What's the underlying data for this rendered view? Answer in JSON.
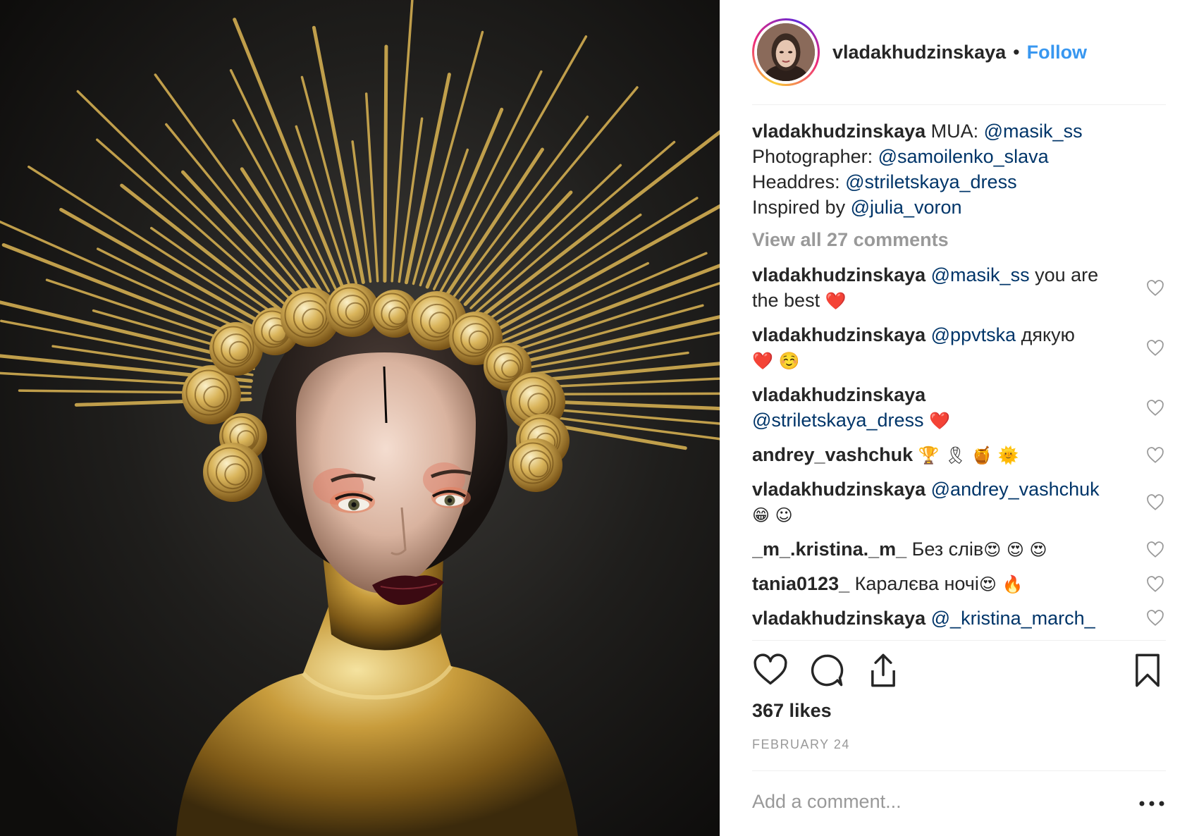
{
  "post": {
    "author": "vladakhudzinskaya",
    "separator": "•",
    "follow_label": "Follow",
    "likes": "367 likes",
    "date": "FEBRUARY 24",
    "add_comment_placeholder": "Add a comment...",
    "view_all_comments": "View all 27 comments"
  },
  "caption": {
    "user": "vladakhudzinskaya",
    "lines": [
      {
        "prefix": " MUA: ",
        "mention": "@masik_ss"
      },
      {
        "prefix": "Photographer: ",
        "mention": "@samoilenko_slava"
      },
      {
        "prefix": "Headdres: ",
        "mention": "@striletskaya_dress"
      },
      {
        "prefix": "Inspired by ",
        "mention": "@julia_voron"
      }
    ]
  },
  "comments": [
    {
      "user": "vladakhudzinskaya",
      "mention": "@masik_ss",
      "text": " you are the best ",
      "emoji": "❤️"
    },
    {
      "user": "vladakhudzinskaya",
      "mention": "@ppvtska",
      "text": " дякую ",
      "emoji": "❤️ ☺️"
    },
    {
      "user": "vladakhudzinskaya",
      "mention": "@striletskaya_dress",
      "text": " ",
      "emoji": "❤️"
    },
    {
      "user": "andrey_vashchuk",
      "mention": "",
      "text": " ",
      "emoji": "🏆 🎗 🍯 🌞"
    },
    {
      "user": "vladakhudzinskaya",
      "mention": "@andrey_vashchuk",
      "text": " ",
      "emoji": "😁 ☺"
    },
    {
      "user": "_m_.kristina._m_",
      "mention": "",
      "text": " Без слів",
      "emoji": "😍 😍 😍"
    },
    {
      "user": "tania0123_",
      "mention": "",
      "text": " Каралєва ночі",
      "emoji": "😍 🔥"
    },
    {
      "user": "vladakhudzinskaya",
      "mention": "@_kristina_march_",
      "text": "",
      "emoji": ""
    }
  ],
  "icons": {
    "like": "heart-icon",
    "comment": "comment-bubble-icon",
    "share": "share-icon",
    "save": "bookmark-icon",
    "more": "more-dots-icon"
  },
  "colors": {
    "follow_blue": "#3897f0",
    "mention_navy": "#003569",
    "muted_gray": "#999999",
    "text_dark": "#262626"
  }
}
